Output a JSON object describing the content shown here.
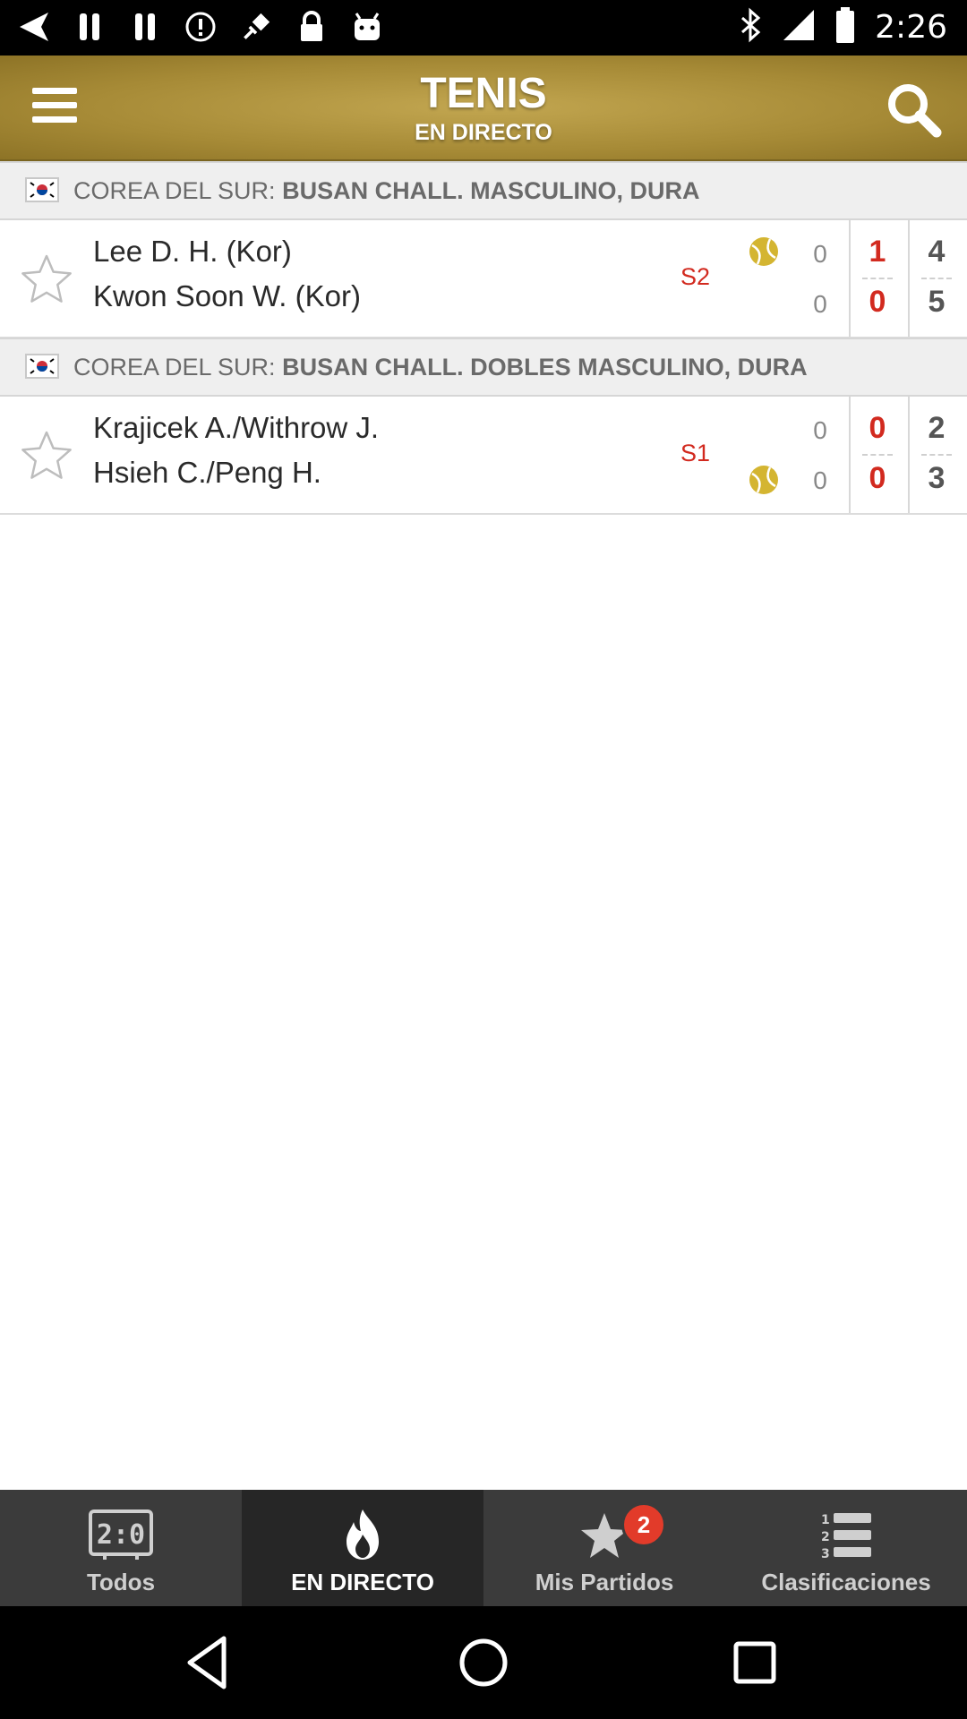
{
  "status_bar": {
    "time": "2:26",
    "icons": [
      "navigation-icon",
      "pause-icon",
      "pause-icon",
      "alert-icon",
      "fake-gps-icon",
      "lock-icon",
      "android-icon",
      "bluetooth-icon",
      "signal-icon",
      "battery-icon"
    ]
  },
  "header": {
    "title": "TENIS",
    "subtitle": "EN DIRECTO",
    "accent_color": "#a68a36"
  },
  "leagues": [
    {
      "country": "COREA DEL SUR:",
      "competition": "BUSAN CHALL. MASCULINO, DURA",
      "match": {
        "player1": "Lee D. H. (Kor)",
        "player2": "Kwon Soon W. (Kor)",
        "set_label": "S2",
        "serving": "player1",
        "game1": "0",
        "game2": "0",
        "set2_p1": "1",
        "set2_p2": "0",
        "set1_p1": "4",
        "set1_p2": "5"
      }
    },
    {
      "country": "COREA DEL SUR:",
      "competition": "BUSAN CHALL. DOBLES MASCULINO, DURA",
      "match": {
        "player1": "Krajicek A./Withrow J.",
        "player2": "Hsieh C./Peng H.",
        "set_label": "S1",
        "serving": "player2",
        "game1": "0",
        "game2": "0",
        "set2_p1": "0",
        "set2_p2": "0",
        "set1_p1": "2",
        "set1_p2": "3"
      }
    }
  ],
  "bottom_nav": {
    "items": [
      {
        "label": "Todos",
        "icon": "scoreboard-icon",
        "active": false
      },
      {
        "label": "EN DIRECTO",
        "icon": "flame-icon",
        "active": true
      },
      {
        "label": "Mis Partidos",
        "icon": "star-icon",
        "badge": "2",
        "active": false
      },
      {
        "label": "Clasificaciones",
        "icon": "ranking-list-icon",
        "active": false
      }
    ]
  },
  "colors": {
    "score_red": "#d22a1f",
    "ball_yellow": "#d4b531"
  }
}
